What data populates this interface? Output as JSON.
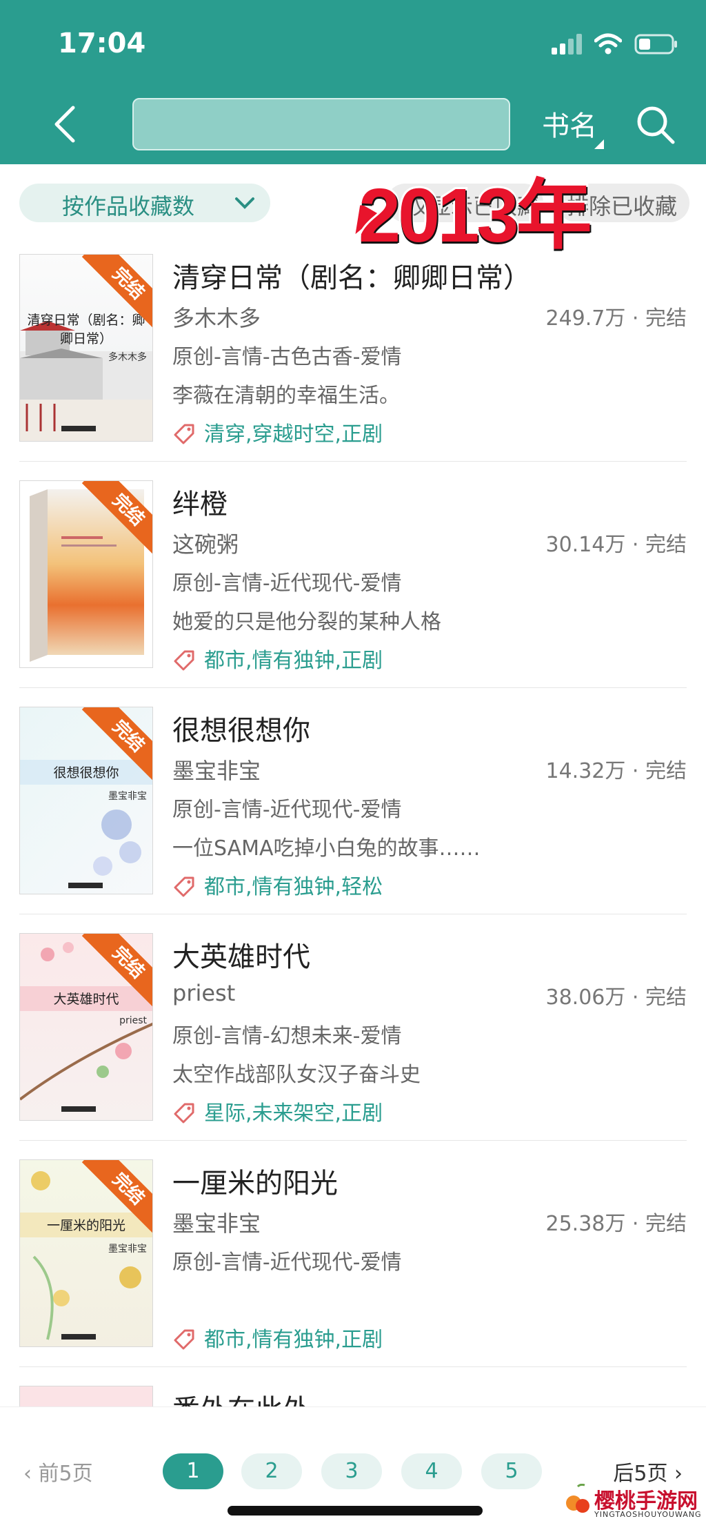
{
  "status_bar": {
    "time": "17:04"
  },
  "header": {
    "search_placeholder": "",
    "search_type": "书名"
  },
  "filters": {
    "sort_label": "按作品收藏数",
    "pill2_label": "仅显示已收藏",
    "pill3_label": "排除已收藏"
  },
  "overlay": {
    "text": "2013年"
  },
  "books": [
    {
      "title": "清穿日常（剧名：卿卿日常）",
      "author": "多木木多",
      "count": "249.7万 · 完结",
      "genre": "原创-言情-古色古香-爱情",
      "desc": "李薇在清朝的幸福生活。",
      "tags": "清穿,穿越时空,正剧",
      "cover_title": "清穿日常（剧名：卿卿日常）",
      "cover_author": "多木木多",
      "ribbon": "完结"
    },
    {
      "title": "绊橙",
      "author": "这碗粥",
      "count": "30.14万 · 完结",
      "genre": "原创-言情-近代现代-爱情",
      "desc": "她爱的只是他分裂的某种人格",
      "tags": "都市,情有独钟,正剧",
      "cover_title": "",
      "cover_author": "",
      "ribbon": "完结"
    },
    {
      "title": "很想很想你",
      "author": "墨宝非宝",
      "count": "14.32万 · 完结",
      "genre": "原创-言情-近代现代-爱情",
      "desc": "一位SAMA吃掉小白兔的故事……",
      "tags": "都市,情有独钟,轻松",
      "cover_title": "很想很想你",
      "cover_author": "墨宝非宝",
      "ribbon": "完结"
    },
    {
      "title": "大英雄时代",
      "author": "priest",
      "count": "38.06万 · 完结",
      "genre": "原创-言情-幻想未来-爱情",
      "desc": "太空作战部队女汉子奋斗史",
      "tags": "星际,未来架空,正剧",
      "cover_title": "大英雄时代",
      "cover_author": "priest",
      "ribbon": "完结"
    },
    {
      "title": "一厘米的阳光",
      "author": "墨宝非宝",
      "count": "25.38万 · 完结",
      "genre": "原创-言情-近代现代-爱情",
      "desc": "",
      "tags": "都市,情有独钟,正剧",
      "cover_title": "一厘米的阳光",
      "cover_author": "墨宝非宝",
      "ribbon": "完结"
    },
    {
      "title": "番外在此外",
      "author": "",
      "count": "",
      "genre": "",
      "desc": "",
      "tags": "",
      "cover_title": "",
      "cover_author": "",
      "ribbon": ""
    }
  ],
  "pagination": {
    "prev": "前5页",
    "next": "后5页",
    "pages": [
      "1",
      "2",
      "3",
      "4",
      "5"
    ],
    "current": "1"
  },
  "watermark": {
    "text": "樱桃手游网",
    "sub": "YINGTAOSHOUYOUWANG"
  },
  "colors": {
    "primary": "#2a9d8f",
    "ribbon": "#e8661e",
    "tag": "#2a9d8f"
  }
}
